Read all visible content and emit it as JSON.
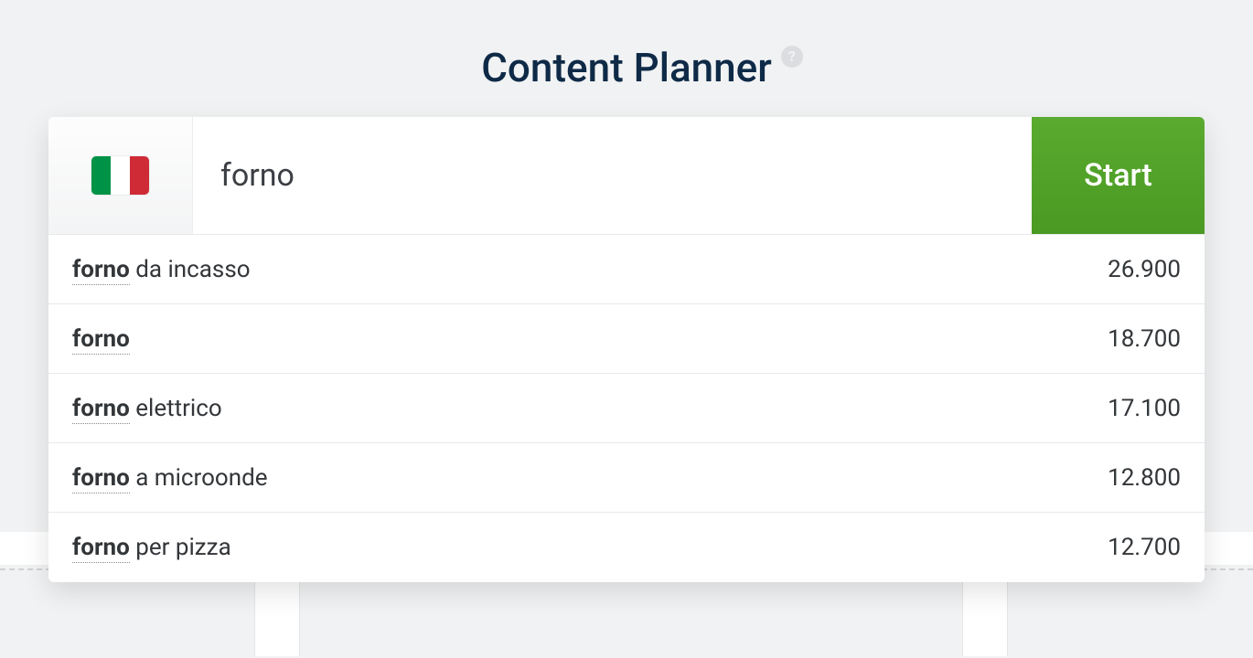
{
  "header": {
    "title": "Content Planner",
    "help_glyph": "?"
  },
  "search": {
    "locale_flag": "italy",
    "input_value": "forno",
    "start_label": "Start"
  },
  "suggestions": [
    {
      "match": "forno",
      "rest": " da incasso",
      "count": "26.900"
    },
    {
      "match": "forno",
      "rest": "",
      "count": "18.700"
    },
    {
      "match": "forno",
      "rest": " elettrico",
      "count": "17.100"
    },
    {
      "match": "forno",
      "rest": " a microonde",
      "count": "12.800"
    },
    {
      "match": "forno",
      "rest": " per pizza",
      "count": "12.700"
    }
  ]
}
